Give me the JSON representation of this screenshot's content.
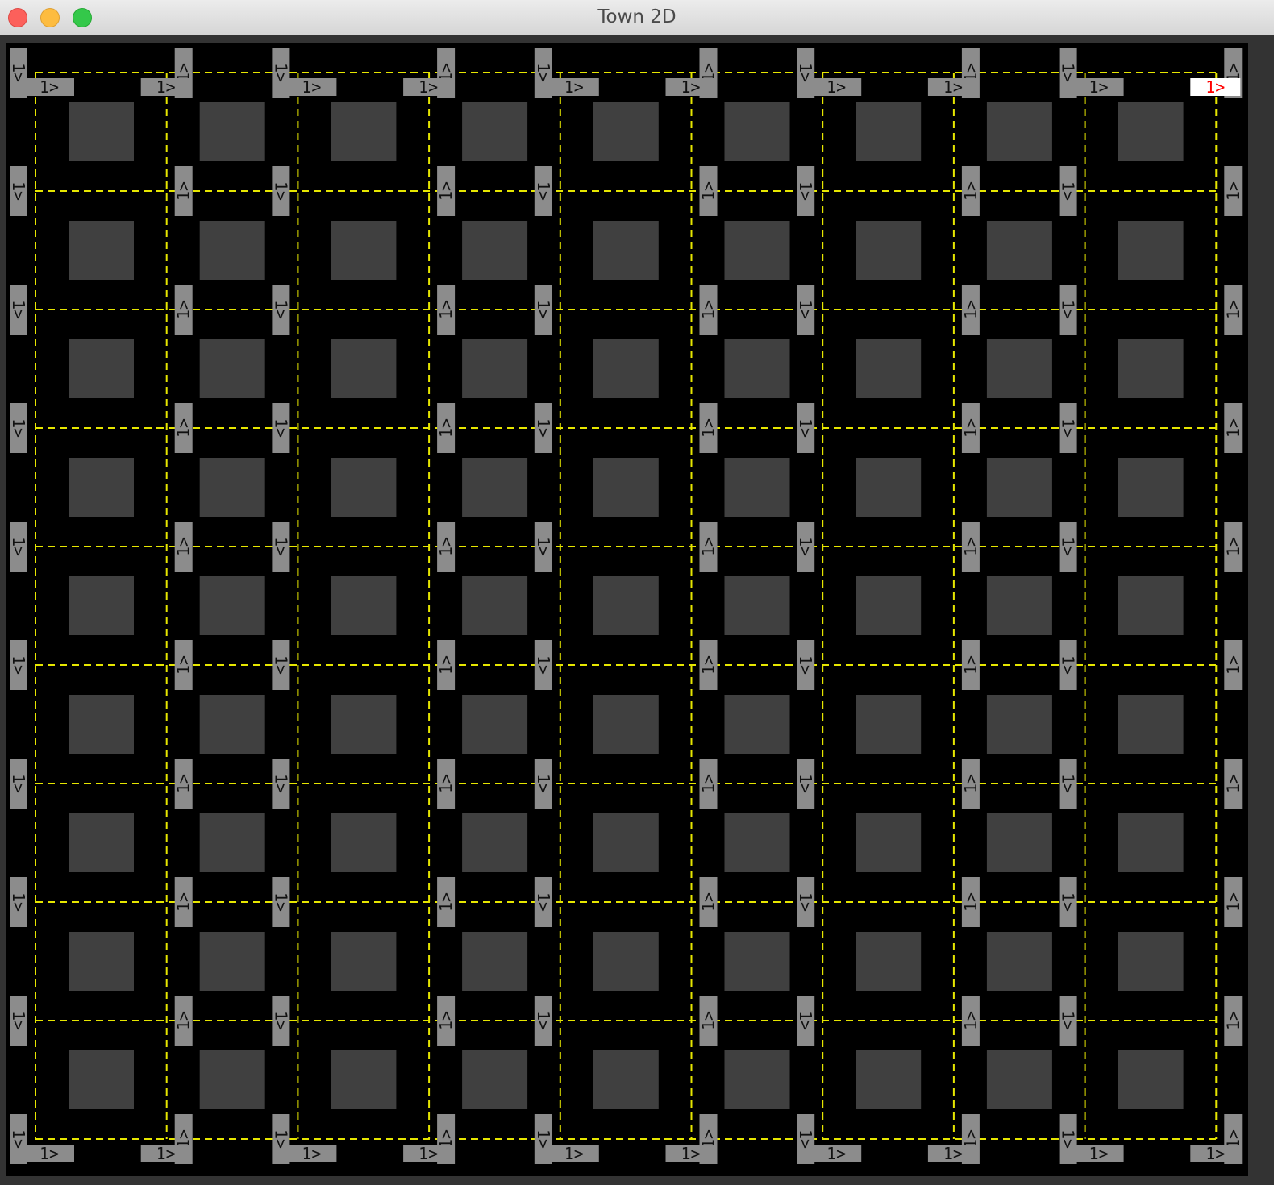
{
  "window": {
    "title": "Town 2D"
  },
  "map": {
    "grid_columns": 10,
    "grid_rows": 10,
    "blocks_per_row": 9,
    "blocks_per_column": 9,
    "sign_label": "1>",
    "active_sign_label": "1>",
    "colors": {
      "background": "#000000",
      "road_line": "#e6e600",
      "block": "#404040",
      "sign": "#8c8c8c",
      "active_sign": "#ffffff",
      "active_text": "#ff0000"
    }
  }
}
